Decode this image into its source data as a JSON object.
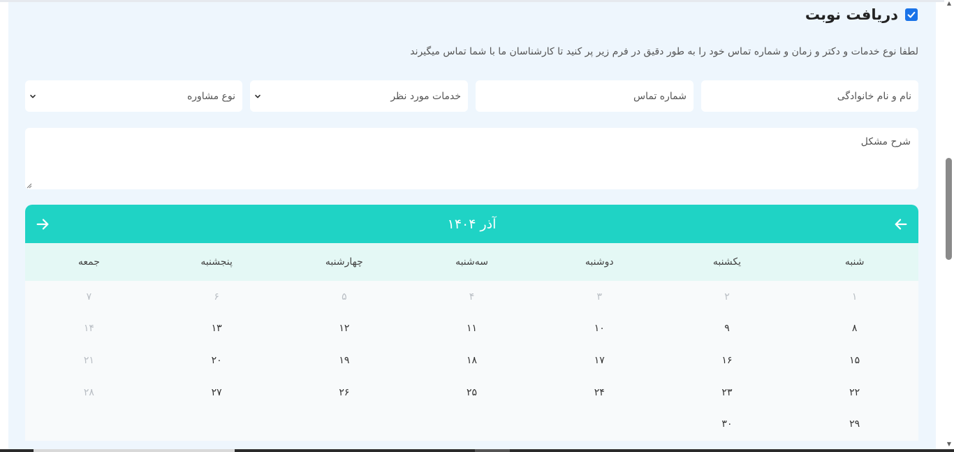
{
  "header": {
    "title": "دریافت نوبت",
    "checkbox_checked": true
  },
  "subtitle": "لطفا نوع خدمات و دکتر و زمان و شماره تماس خود را به طور دقیق در فرم زیر پر کنید تا کارشناسان ما با شما تماس میگیرند",
  "form": {
    "name_placeholder": "نام و نام خانوادگی",
    "phone_placeholder": "شماره تماس",
    "services_select": "خدمات مورد نظر",
    "consult_select": "نوع مشاوره",
    "description_placeholder": "شرح مشکل"
  },
  "calendar": {
    "month_label": "آذر ۱۴۰۴",
    "weekdays": [
      "شنبه",
      "یکشنبه",
      "دوشنبه",
      "سه‌شنبه",
      "چهارشنبه",
      "پنجشنبه",
      "جمعه"
    ],
    "days": [
      {
        "label": "۱",
        "muted": true
      },
      {
        "label": "۲",
        "muted": true
      },
      {
        "label": "۳",
        "muted": true
      },
      {
        "label": "۴",
        "muted": true
      },
      {
        "label": "۵",
        "muted": true
      },
      {
        "label": "۶",
        "muted": true
      },
      {
        "label": "۷",
        "muted": true
      },
      {
        "label": "۸",
        "muted": false
      },
      {
        "label": "۹",
        "muted": false
      },
      {
        "label": "۱۰",
        "muted": false
      },
      {
        "label": "۱۱",
        "muted": false
      },
      {
        "label": "۱۲",
        "muted": false
      },
      {
        "label": "۱۳",
        "muted": false
      },
      {
        "label": "۱۴",
        "muted": true
      },
      {
        "label": "۱۵",
        "muted": false
      },
      {
        "label": "۱۶",
        "muted": false
      },
      {
        "label": "۱۷",
        "muted": false
      },
      {
        "label": "۱۸",
        "muted": false
      },
      {
        "label": "۱۹",
        "muted": false
      },
      {
        "label": "۲۰",
        "muted": false
      },
      {
        "label": "۲۱",
        "muted": true
      },
      {
        "label": "۲۲",
        "muted": false
      },
      {
        "label": "۲۳",
        "muted": false
      },
      {
        "label": "۲۴",
        "muted": false
      },
      {
        "label": "۲۵",
        "muted": false
      },
      {
        "label": "۲۶",
        "muted": false
      },
      {
        "label": "۲۷",
        "muted": false
      },
      {
        "label": "۲۸",
        "muted": true
      },
      {
        "label": "۲۹",
        "muted": false
      },
      {
        "label": "۳۰",
        "muted": false
      }
    ]
  },
  "colors": {
    "accent": "#1fd3c5",
    "checkbox": "#1a73e8"
  },
  "icons": {
    "prev": "arrow-left-icon",
    "next": "arrow-right-icon",
    "select": "chevron-down-icon"
  }
}
